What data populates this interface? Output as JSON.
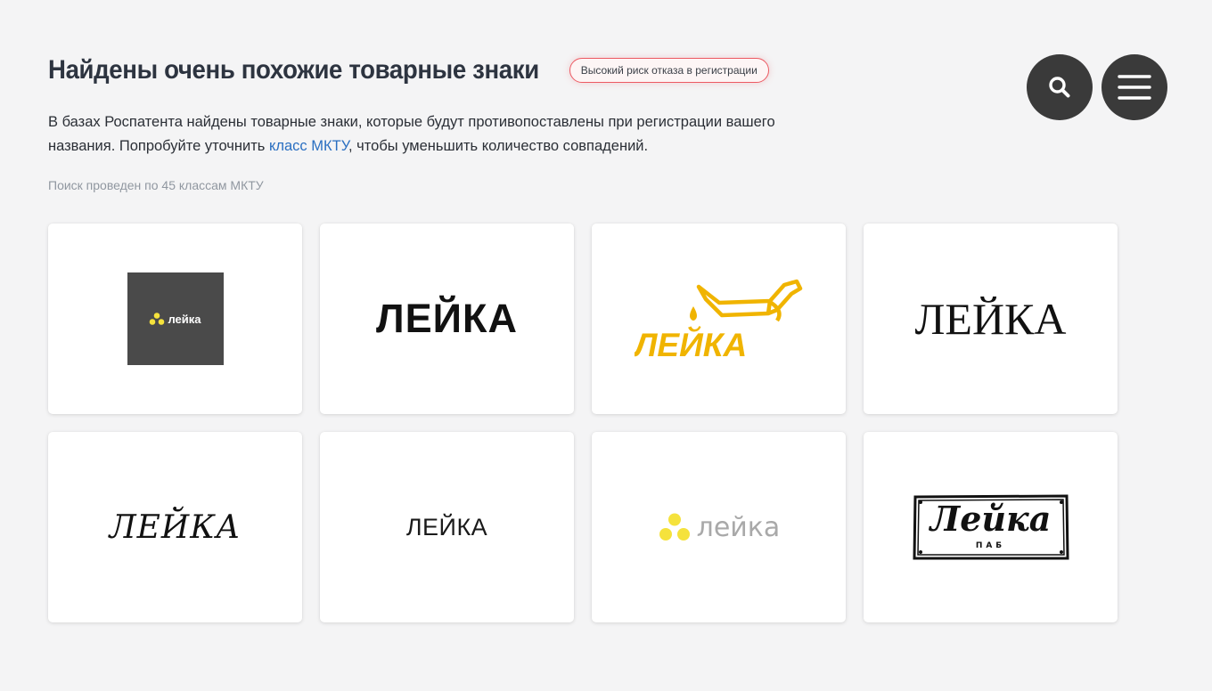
{
  "header": {
    "title": "Найдены очень похожие товарные знаки",
    "risk_badge": "Высокий риск отказа в регистрации"
  },
  "description": {
    "part1": "В базах Роспатента найдены товарные знаки, которые будут противопоставлены при регистрации вашего названия. Попробуйте уточнить ",
    "link": "класс МКТУ",
    "part2": ", чтобы уменьшить количество совпадений."
  },
  "search_note": "Поиск проведен по 45 классам МКТУ",
  "nav": {
    "search_icon": "search-icon",
    "menu_icon": "hamburger-menu-icon"
  },
  "trademarks": [
    {
      "text": "лейка",
      "style": "white bold text with yellow dot cluster on dark gray square"
    },
    {
      "text": "ЛЕЙКА",
      "style": "bold black sans-serif"
    },
    {
      "text": "ЛЕЙКА",
      "style": "yellow bold with watering can and drop"
    },
    {
      "text": "ЛЕЙКА",
      "style": "black serif"
    },
    {
      "text": "ЛЕЙКА",
      "style": "black italic serif"
    },
    {
      "text": "ЛЕЙКА",
      "style": "light black sans-serif"
    },
    {
      "text": "лейка",
      "style": "gray text with yellow dot cluster"
    },
    {
      "text": "Лейка",
      "sub": "ПАБ",
      "style": "hand-drawn framed sign"
    }
  ],
  "colors": {
    "background": "#f4f4f5",
    "link": "#2a6fc1",
    "badge_border": "#ec5a63",
    "button_bg": "#3a3a3a",
    "logo_yellow": "#f0b400",
    "dot_yellow": "#f5e23c"
  }
}
